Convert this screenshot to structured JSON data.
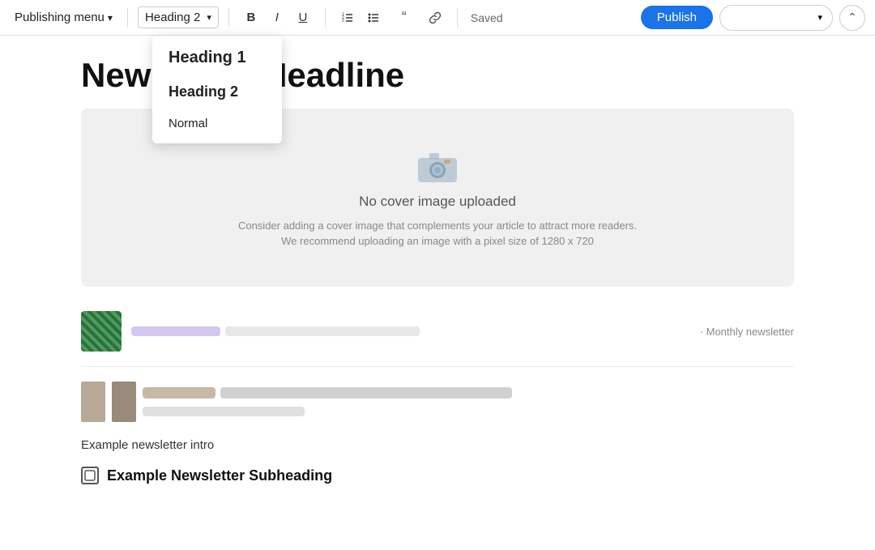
{
  "toolbar": {
    "publishing_menu_label": "Publishing menu",
    "chevron_down": "▾",
    "heading_select_label": "Heading 2",
    "bold_label": "B",
    "italic_label": "I",
    "underline_label": "U",
    "ordered_list_icon": "≡",
    "unordered_list_icon": "≡",
    "blockquote_icon": "❝",
    "link_icon": "🔗",
    "saved_label": "Saved",
    "publish_label": "Publish",
    "collapse_icon": "⌃"
  },
  "heading_dropdown": {
    "items": [
      {
        "label": "Heading 1",
        "type": "h1"
      },
      {
        "label": "Heading 2",
        "type": "h2"
      },
      {
        "label": "Normal",
        "type": "normal"
      }
    ]
  },
  "content": {
    "headline": "Newsletter Headline",
    "cover_image_title": "No cover image uploaded",
    "cover_image_desc_line1": "Consider adding a cover image that complements your article to attract more readers.",
    "cover_image_desc_line2": "We recommend uploading an image with a pixel size of 1280 x 720",
    "article_tag": "· Monthly newsletter",
    "newsletter_intro": "Example newsletter intro",
    "subheading": "Example Newsletter Subheading"
  }
}
